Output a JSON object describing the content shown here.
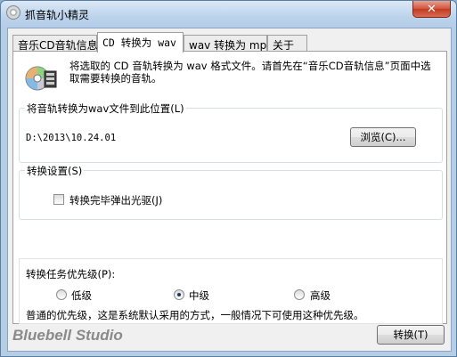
{
  "window": {
    "title": "抓音轨小精灵",
    "close_label": "✕",
    "icon": "cd-disc-icon"
  },
  "tabs": [
    {
      "label": "音乐CD音轨信息",
      "active": false
    },
    {
      "label": "CD 转换为 wav",
      "active": true
    },
    {
      "label": "wav 转换为 mp3",
      "active": false
    },
    {
      "label": "关于",
      "active": false
    }
  ],
  "intro": {
    "icon": "cd-convert-icon",
    "text": "将选取的 CD 音轨转换为 wav 格式文件。请首先在“音乐CD音轨信息”页面中选取需要转换的音轨。"
  },
  "output_group": {
    "label": "将音轨转换为wav文件到此位置(L)",
    "path": "D:\\2013\\10.24.01",
    "browse_label": "浏览(C)..."
  },
  "convert_settings": {
    "label": "转换设置(S)",
    "eject_label": "转换完毕弹出光驱(J)",
    "eject_checked": false
  },
  "priority": {
    "label": "转换任务优先级(P):",
    "options": [
      {
        "label": "低级",
        "selected": false
      },
      {
        "label": "中级",
        "selected": true
      },
      {
        "label": "高级",
        "selected": false
      }
    ],
    "description": "普通的优先级，这是系统默认采用的方式，一般情况下可使用这种优先级。"
  },
  "footer": {
    "brand": "Bluebell Studio",
    "convert_label": "转换(T)"
  }
}
